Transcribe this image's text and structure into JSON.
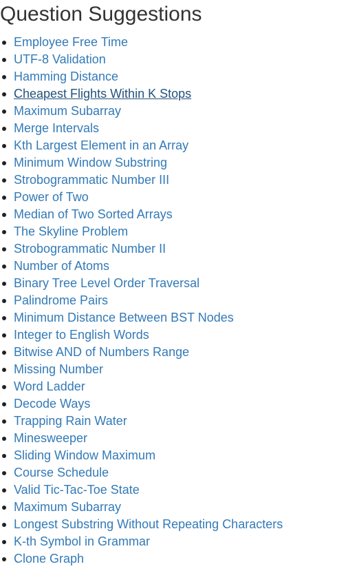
{
  "page": {
    "title": "Question Suggestions"
  },
  "suggestions": [
    {
      "label": "Employee Free Time"
    },
    {
      "label": "UTF-8 Validation"
    },
    {
      "label": "Hamming Distance"
    },
    {
      "label": "Cheapest Flights Within K Stops",
      "hovered": true
    },
    {
      "label": "Maximum Subarray"
    },
    {
      "label": "Merge Intervals"
    },
    {
      "label": "Kth Largest Element in an Array"
    },
    {
      "label": "Minimum Window Substring"
    },
    {
      "label": "Strobogrammatic Number III"
    },
    {
      "label": "Power of Two"
    },
    {
      "label": "Median of Two Sorted Arrays"
    },
    {
      "label": "The Skyline Problem"
    },
    {
      "label": "Strobogrammatic Number II"
    },
    {
      "label": "Number of Atoms"
    },
    {
      "label": "Binary Tree Level Order Traversal"
    },
    {
      "label": "Palindrome Pairs"
    },
    {
      "label": "Minimum Distance Between BST Nodes"
    },
    {
      "label": "Integer to English Words"
    },
    {
      "label": "Bitwise AND of Numbers Range"
    },
    {
      "label": "Missing Number"
    },
    {
      "label": "Word Ladder"
    },
    {
      "label": "Decode Ways"
    },
    {
      "label": "Trapping Rain Water"
    },
    {
      "label": "Minesweeper"
    },
    {
      "label": "Sliding Window Maximum"
    },
    {
      "label": "Course Schedule"
    },
    {
      "label": "Valid Tic-Tac-Toe State"
    },
    {
      "label": "Maximum Subarray"
    },
    {
      "label": "Longest Substring Without Repeating Characters"
    },
    {
      "label": "K-th Symbol in Grammar"
    },
    {
      "label": "Clone Graph"
    }
  ],
  "colors": {
    "link": "#337ab7",
    "link_hover": "#23527c",
    "title": "#333333",
    "bullet": "#222222"
  }
}
